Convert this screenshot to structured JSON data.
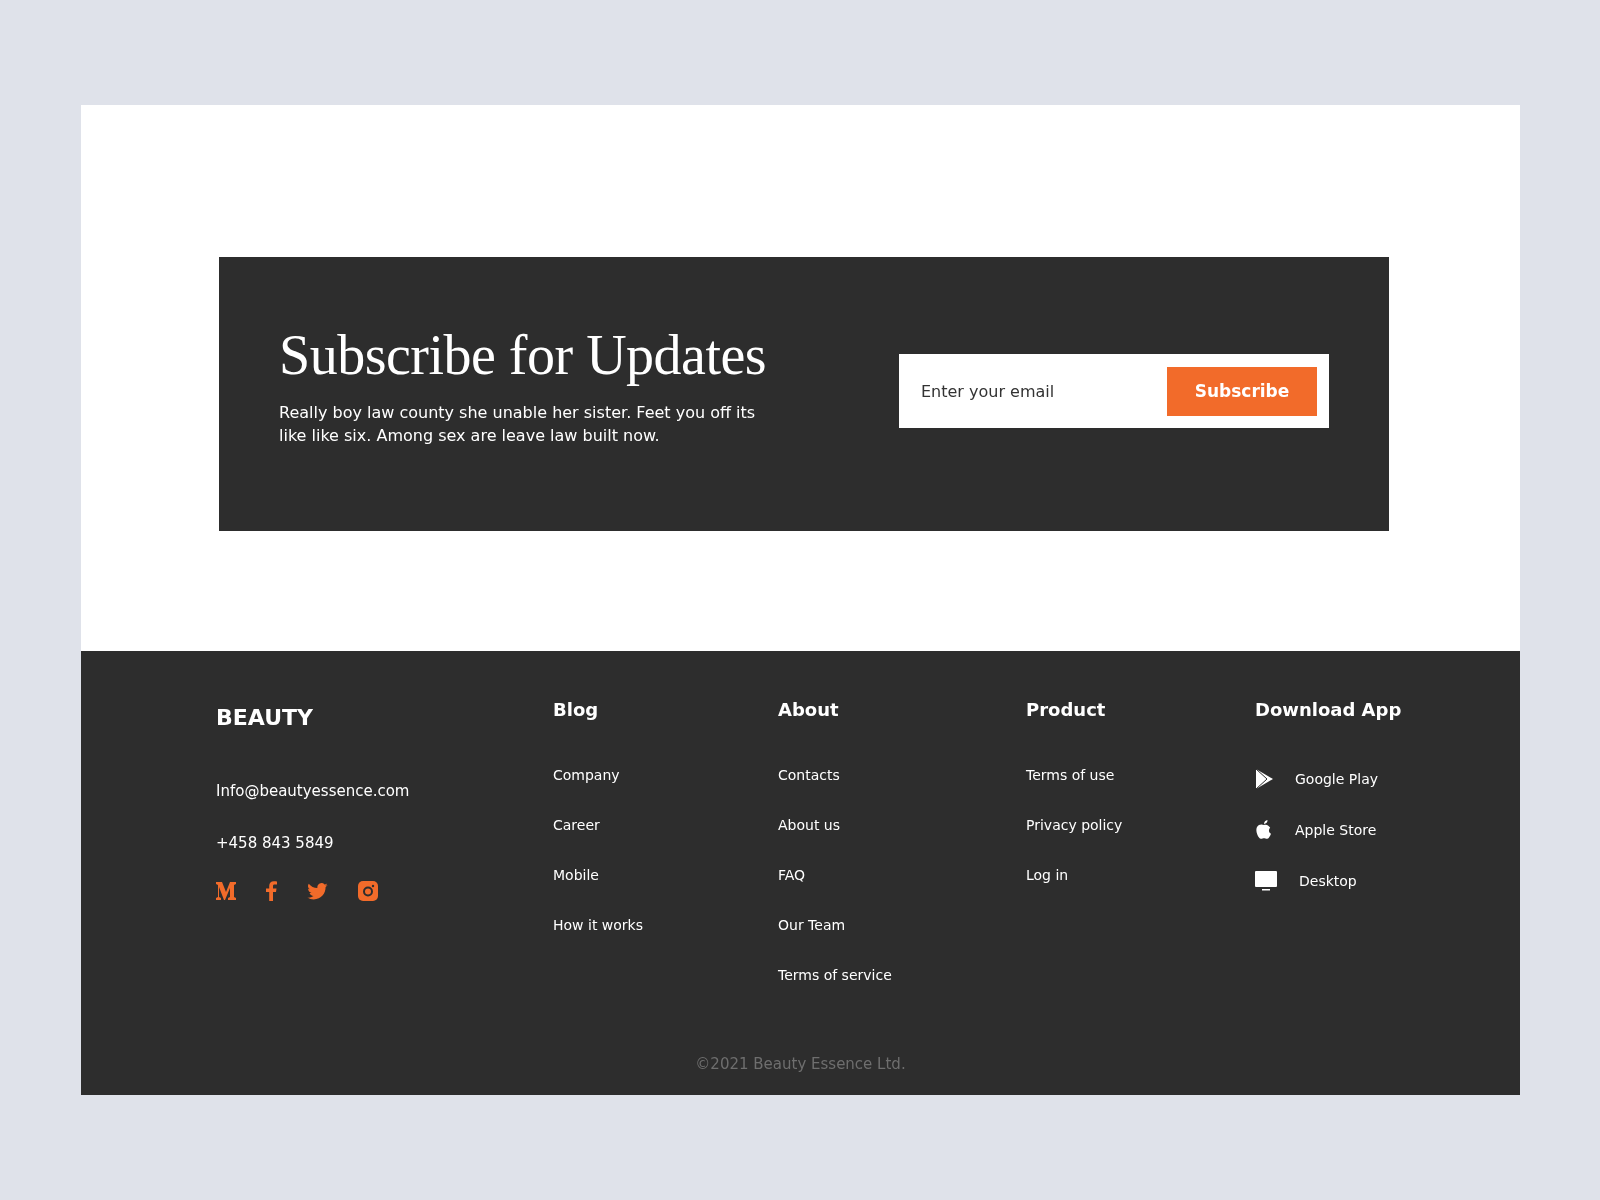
{
  "subscribe": {
    "title": "Subscribe for Updates",
    "text": "Really boy law county she unable her sister. Feet you off its like like six. Among sex are leave law built now.",
    "email": {
      "placeholder": "Enter your email"
    },
    "button": "Subscribe"
  },
  "footer": {
    "brand": "BEAUTY",
    "email": "Info@beautyessence.com",
    "phone": "+458 843 5849",
    "social": [
      {
        "kind": "medium"
      },
      {
        "kind": "facebook"
      },
      {
        "kind": "twitter"
      },
      {
        "kind": "instagram"
      }
    ],
    "columns": [
      {
        "title": "Blog",
        "links": [
          "Company",
          "Career",
          "Mobile",
          "How it works"
        ]
      },
      {
        "title": "About",
        "links": [
          "Contacts",
          "About us",
          "FAQ",
          "Our Team",
          "Terms of service"
        ]
      },
      {
        "title": "Product",
        "links": [
          "Terms of use",
          "Privacy policy",
          "Log in"
        ]
      }
    ],
    "apps": {
      "title": "Download App",
      "items": [
        {
          "kind": "play",
          "label": "Google Play"
        },
        {
          "kind": "apple",
          "label": "Apple Store"
        },
        {
          "kind": "desktop",
          "label": "Desktop"
        }
      ]
    },
    "copyright": "©2021 Beauty Essence Ltd."
  }
}
